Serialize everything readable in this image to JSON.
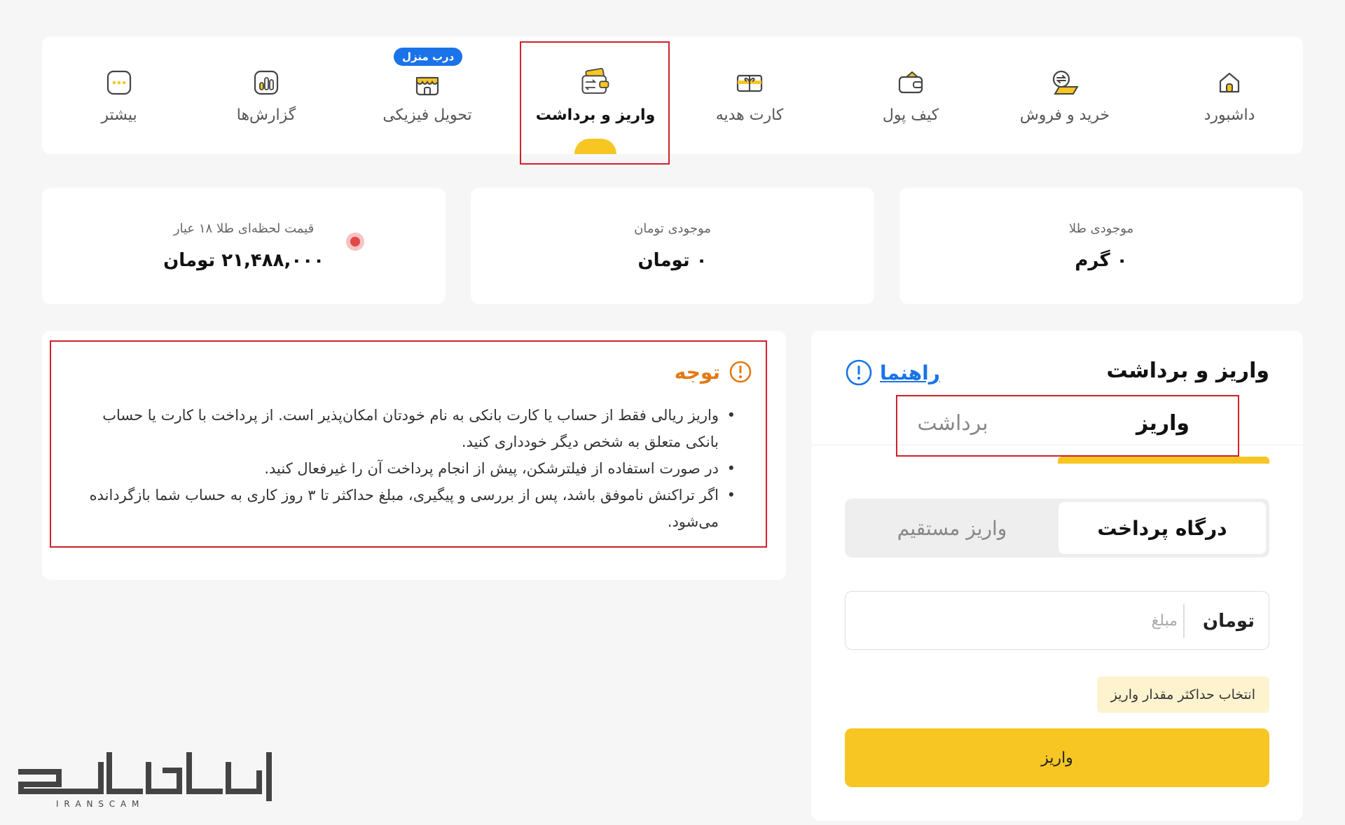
{
  "nav": {
    "items": [
      {
        "label": "داشبورد",
        "icon": "home-icon"
      },
      {
        "label": "خرید و فروش",
        "icon": "exchange-icon"
      },
      {
        "label": "کیف پول",
        "icon": "wallet-icon"
      },
      {
        "label": "کارت هدیه",
        "icon": "gift-card-icon"
      },
      {
        "label": "واریز و برداشت",
        "icon": "deposit-withdraw-icon",
        "active": true
      },
      {
        "label": "تحویل فیزیکی",
        "icon": "store-icon",
        "badge": "درب منزل"
      },
      {
        "label": "گزارش‌ها",
        "icon": "reports-icon"
      },
      {
        "label": "بیشتر",
        "icon": "more-icon"
      }
    ]
  },
  "stats": {
    "gold_balance": {
      "title": "موجودی طلا",
      "value": "۰ گرم"
    },
    "toman_balance": {
      "title": "موجودی تومان",
      "value": "۰ تومان"
    },
    "gold_price": {
      "title": "قیمت لحظه‌ای طلا ۱۸ عیار",
      "value": "۲۱,۴۸۸,۰۰۰ تومان"
    }
  },
  "notice": {
    "title": "توجه",
    "items": [
      "واریز ریالی فقط از حساب یا کارت بانکی به نام خودتان امکان‌پذیر است. از پرداخت با کارت یا حساب بانکی متعلق به شخص دیگر خودداری کنید.",
      "در صورت استفاده از فیلترشکن، پیش از انجام پرداخت آن را غیرفعال کنید.",
      "اگر تراکنش ناموفق باشد، پس از بررسی و پیگیری، مبلغ حداکثر تا ۳ روز کاری به حساب شما بازگردانده می‌شود."
    ]
  },
  "panel": {
    "title": "واریز و برداشت",
    "guide": "راهنما",
    "tabs": {
      "deposit": "واریز",
      "withdraw": "برداشت"
    },
    "methods": {
      "gateway": "درگاه پرداخت",
      "direct": "واریز مستقیم"
    },
    "amount": {
      "placeholder": "مبلغ",
      "value": "",
      "unit": "تومان"
    },
    "max_label": "انتخاب حداکثر مقدار واریز",
    "submit_label": "واریز"
  },
  "watermark": {
    "text": "ایران اسکم",
    "subtitle": "I R A N   S C A M"
  },
  "colors": {
    "accent": "#f7c622",
    "link": "#1a73e8",
    "warning": "#e27a14",
    "highlight": "#d0202a",
    "live": "#e34848"
  }
}
